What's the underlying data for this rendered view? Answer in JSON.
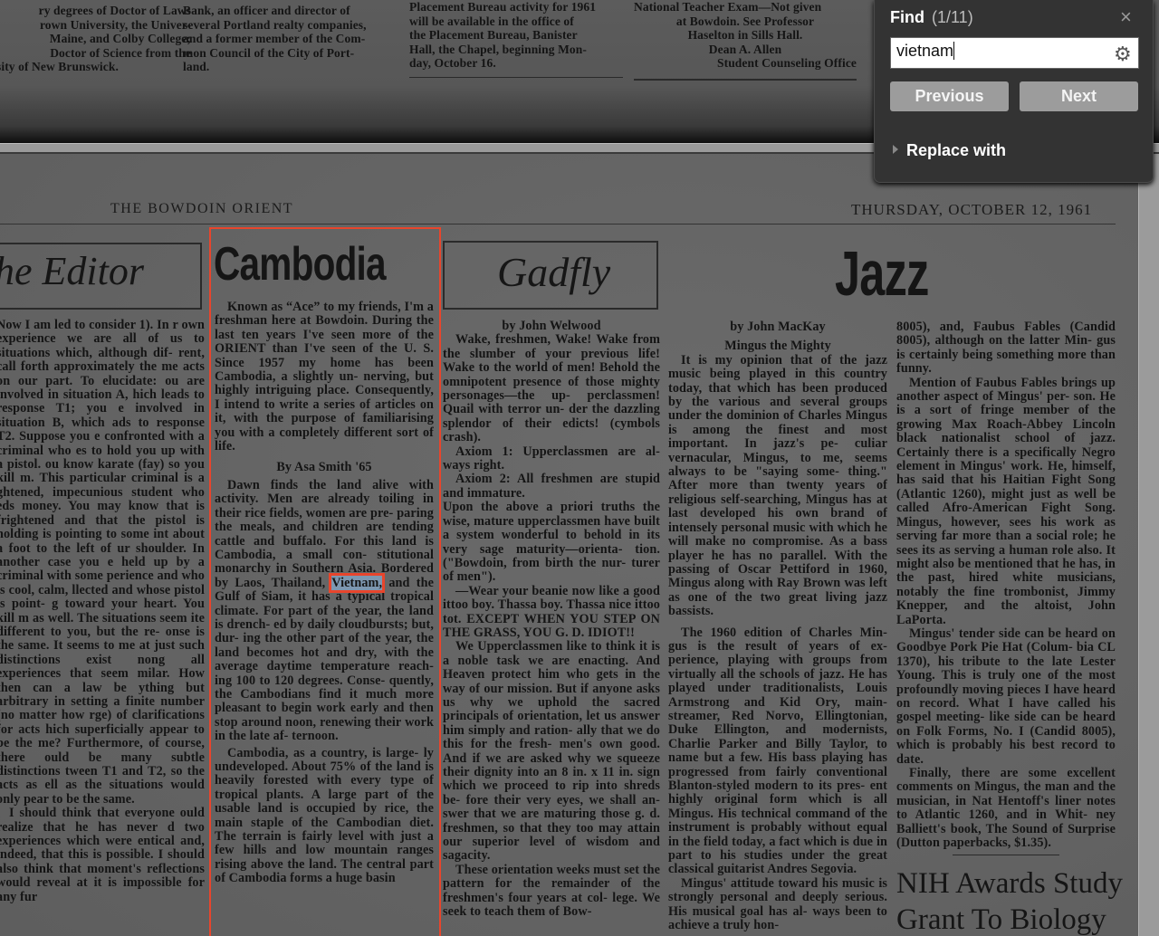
{
  "app": {
    "find_panel": {
      "title": "Find",
      "count": "(1/11)",
      "close_icon": "×",
      "query": "vietnam",
      "gear_icon": "⚙",
      "previous_label": "Previous",
      "next_label": "Next",
      "replace_label": "Replace with",
      "highlight_color": "#7d97b0",
      "match_border_color": "#e8452c"
    }
  },
  "prev_page": {
    "col1": [
      "ry degrees of Doctor of Laws",
      "rown University, the Univer-",
      " Maine, and Colby College;",
      " Doctor of Science from the",
      "sity of New Brunswick."
    ],
    "col2": [
      "Bank, an officer and director of",
      "several Portland realty companies,",
      "and a former member of the Com-",
      "mon Council of the City of Port-",
      "land."
    ],
    "col3": [
      "Placement Bureau activity for 1961",
      "will be available in the office of",
      "the Placement Bureau, Banister",
      "Hall, the Chapel, beginning Mon-",
      "day, October 16."
    ],
    "col4": [
      "National Teacher Exam—Not given",
      "at Bowdoin. See Professor",
      "Haselton in Sills Hall.",
      "Dean A. Allen",
      "Student Counseling Office"
    ]
  },
  "page": {
    "masthead": "THE BOWDOIN ORIENT",
    "date": "THURSDAY, OCTOBER 12, 1961",
    "editor": {
      "heading": "he Editor",
      "paragraphs": [
        "Now I am led to consider 1). In r own experience we are all of us to situations which, although dif- rent, call forth approximately the me acts on our part. To elucidate: ou are involved in situation A, hich leads to response T1; you e involved in situation B, which ads to response T2. Suppose you e confronted with a criminal who es to hold you up with a pistol. ou know karate (fay) so you kill m. This particular criminal is a ghtened, impecunious student who eds money. You may know that is frightened and that the pistol is holding is pointing to some int about a foot to the left of ur shoulder. In another case you e held up by a criminal with some perience and who is cool, calm, llected and whose pistol is point- g toward your heart. You kill m as well. The situations seem ite different to you, but the re- onse is the same. It seems to me at just such distinctions exist nong all experiences that seem milar. How then can a law be ything but arbitrary in setting a finite number (no matter how rge) of clarifications for acts hich superficially appear to be the me? Furthermore, of course, there ould be many subtle distinctions tween T1 and T2, so the acts as ell as the situations would only pear to be the same.",
        "I should think that everyone ould realize that he has never d two experiences which were entical and, indeed, that this is possible. I should also think that moment's reflections would reveal at it is impossible for any fur"
      ]
    },
    "cambodia": {
      "heading": "Cambodia",
      "intro": "Known as “Ace” to my friends, I'm a freshman here at Bowdoin. During the last ten years I've seen more of the ORIENT than I've seen of the U. S. Since 1957 my home has been Cambodia, a slightly un- nerving, but highly intriguing place. Consequently, I intend to write a series of articles on it, with the purpose of familiarising you with a completely different sort of life.",
      "byline": "By Asa Smith '65",
      "p1_before": "Dawn finds the land alive with activity. Men are already toiling in their rice fields, women are pre- paring the meals, and children are tending cattle and buffalo. For this land is Cambodia, a small con- stitutional monarchy in Southern Asia. Bordered by Laos, Thailand,",
      "match_text": "Vietnam,",
      "p1_after": "and the Gulf of Siam, it has a typical tropical climate. For part of the year, the land is drench- ed by daily cloudbursts; but, dur- ing the other part of the year, the land becomes hot and dry, with the average daytime temperature reach- ing 100 to 120 degrees. Conse- quently, the Cambodians find it much more pleasant to begin work early and then stop around noon, renewing their work in the late af- ternoon.",
      "p2": "Cambodia, as a country, is large- ly undeveloped. About 75% of the land is heavily forested with every type of tropical plants. A large part of the usable land is occupied by rice, the main staple of the Cambodian diet. The terrain is fairly level with just a few hills and low mountain ranges rising above the land. The central part of Cambodia forms a huge basin"
    },
    "gadfly": {
      "heading": "Gadfly",
      "byline": "by John Welwood",
      "paragraphs": [
        "Wake, freshmen, Wake! Wake from the slumber of your previous life! Wake to the world of men! Behold the omnipotent presence of those mighty personages—the up- perclassmen! Quail with terror un- der the dazzling splendor of their edicts! (cymbols crash).",
        "Axiom 1: Upperclassmen are al- ways right.",
        "Axiom 2: All freshmen are stupid and immature.",
        "Upon the above a priori truths the wise, mature upperclassmen have built a system wonderful to behold in its very sage maturity—orienta- tion. (\"Bowdoin, from birth the nur- turer of men\").",
        "—Wear your beanie now like a good ittoo boy. Thassa boy. Thassa nice ittoo tot. EXCEPT WHEN YOU STEP ON THE GRASS, YOU G. D. IDIOT!!",
        "We Upperclassmen like to think it is a noble task we are enacting. And Heaven protect him who gets in the way of our mission. But if anyone asks us why we uphold the sacred principals of orientation, let us answer him simply and ration- ally that we do this for the fresh- men's own good. And if we are asked why we squeeze their dignity into an 8 in. x 11 in. sign which we proceed to rip into shreds be- fore their very eyes, we shall an- swer that we are maturing those g. d. freshmen, so that they too may attain our superior level of wisdom and sagacity.",
        "These orientation weeks must set the pattern for the remainder of the freshmen's four years at col- lege. We seek to teach them of Bow-"
      ]
    },
    "jazz": {
      "heading": "Jazz",
      "byline": "by John MacKay",
      "subhead": "Mingus the Mighty",
      "col1": [
        "It is my opinion that of the jazz music being played in this country today, that which has been produced by the various and several groups under the dominion of Charles Mingus is among the finest and most important. In jazz's pe- culiar vernacular, Mingus, to me, seems always to be \"saying some- thing.\" After more than twenty years of religious self-searching, Mingus has at last developed his own brand of intensely personal music with which he will make no compromise. As a bass player he has no parallel. With the passing of Oscar Pettiford in 1960, Mingus along with Ray Brown was left as one of the two great living jazz bassists.",
        "The 1960 edition of Charles Min- gus is the result of years of ex- perience, playing with groups from virtually all the schools of jazz. He has played under traditionalists, Louis Armstrong and Kid Ory, main- streamer, Red Norvo, Ellingtonian, Duke Ellington, and modernists, Charlie Parker and Billy Taylor, to name but a few. His bass playing has progressed from fairly conventional Blanton-styled modern to its pres- ent highly original form which is all Mingus. His technical command of the instrument is probably without equal in the field today, a fact which is due in part to his studies under the great classical guitarist Andres Segovia.",
        "Mingus' attitude toward his music is strongly personal and deeply serious. His musical goal has al- ways been to achieve a truly hon-"
      ],
      "col2": [
        "8005), and, Faubus Fables (Candid 8005), although on the latter Min- gus is certainly being something more than funny.",
        "Mention of Faubus Fables brings up another aspect of Mingus' per- son. He is a sort of fringe member of the growing Max Roach-Abbey Lincoln black nationalist school of jazz. Certainly there is a specifically Negro element in Mingus' work. He, himself, has said that his Haitian Fight Song (Atlantic 1260), might just as well be called Afro-American Fight Song. Mingus, however, sees his work as serving far more than a social role; he sees its as serving a human role also. It might also be mentioned that he has, in the past, hired white musicians, notably the fine trombonist, Jimmy Knepper, and the altoist, John LaPorta.",
        "Mingus' tender side can be heard on Goodbye Pork Pie Hat (Colum- bia CL 1370), his tribute to the late Lester Young. This is truly one of the most profoundly moving pieces I have heard on record. What I have called his gospel meeting- like side can be heard on Folk Forms, No. I (Candid 8005), which is probably his best record to date.",
        "Finally, there are some excellent comments on Mingus, the man and the musician, in Nat Hentoff's liner notes to Atlantic 1260, and in Whit- ney Balliett's book, The Sound of Surprise (Dutton paperbacks, $1.35)."
      ]
    },
    "nih": {
      "line1": "NIH Awards Study",
      "line2": "Grant To Biology"
    }
  }
}
